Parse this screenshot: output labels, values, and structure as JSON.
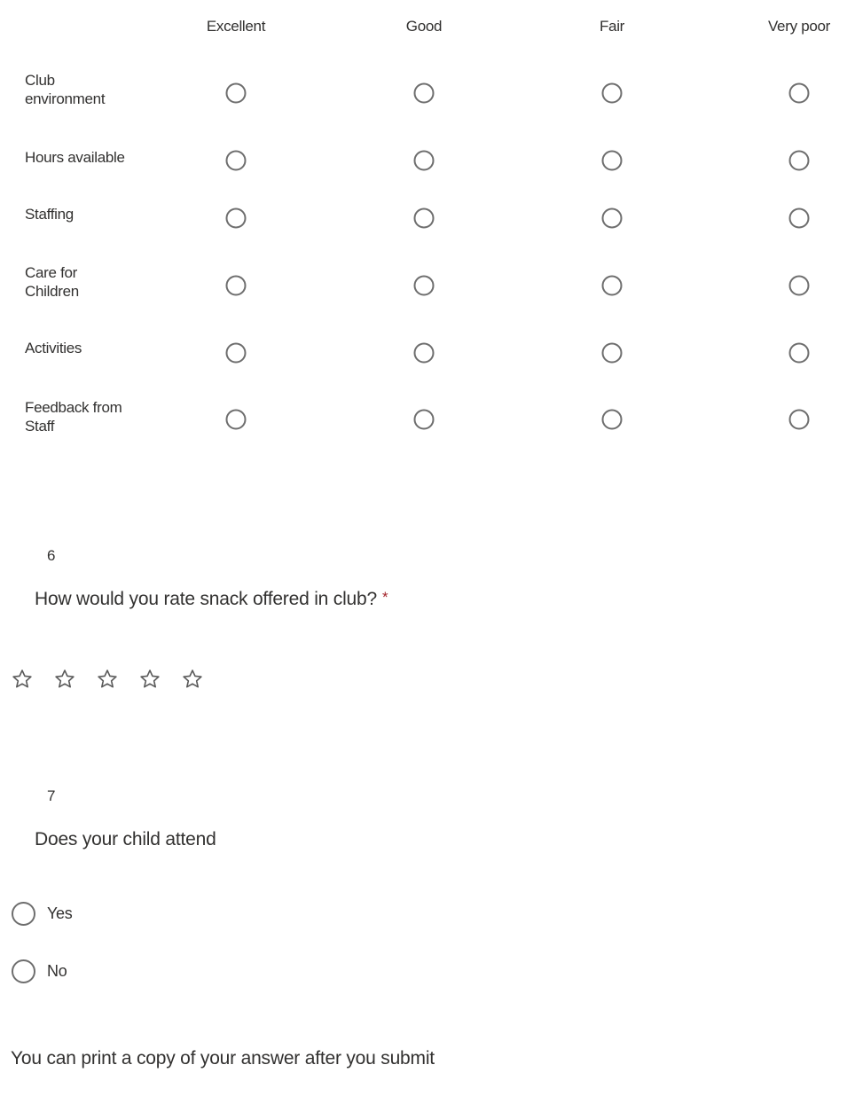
{
  "likert": {
    "columns": [
      "Excellent",
      "Good",
      "Fair",
      "Very poor"
    ],
    "rows": [
      {
        "label": "Club environment",
        "selected": null
      },
      {
        "label": "Hours available",
        "selected": null
      },
      {
        "label": "Staffing",
        "selected": null
      },
      {
        "label": "Care for Children",
        "selected": null
      },
      {
        "label": "Activities",
        "selected": null
      },
      {
        "label": "Feedback from Staff",
        "selected": null
      }
    ]
  },
  "question6": {
    "number": "6",
    "title": "How would you rate snack offered in club?",
    "required_marker": "*",
    "rating": {
      "max": 5,
      "value": 0,
      "icon": "star-outline-icon"
    }
  },
  "question7": {
    "number": "7",
    "title": "Does your child attend",
    "options": [
      "Yes",
      "No"
    ],
    "selected": null
  },
  "footer": {
    "note": "You can print a copy of your answer after you submit"
  },
  "colors": {
    "text": "#323130",
    "required": "#a4262c",
    "radio_border": "#6e6e6e"
  }
}
